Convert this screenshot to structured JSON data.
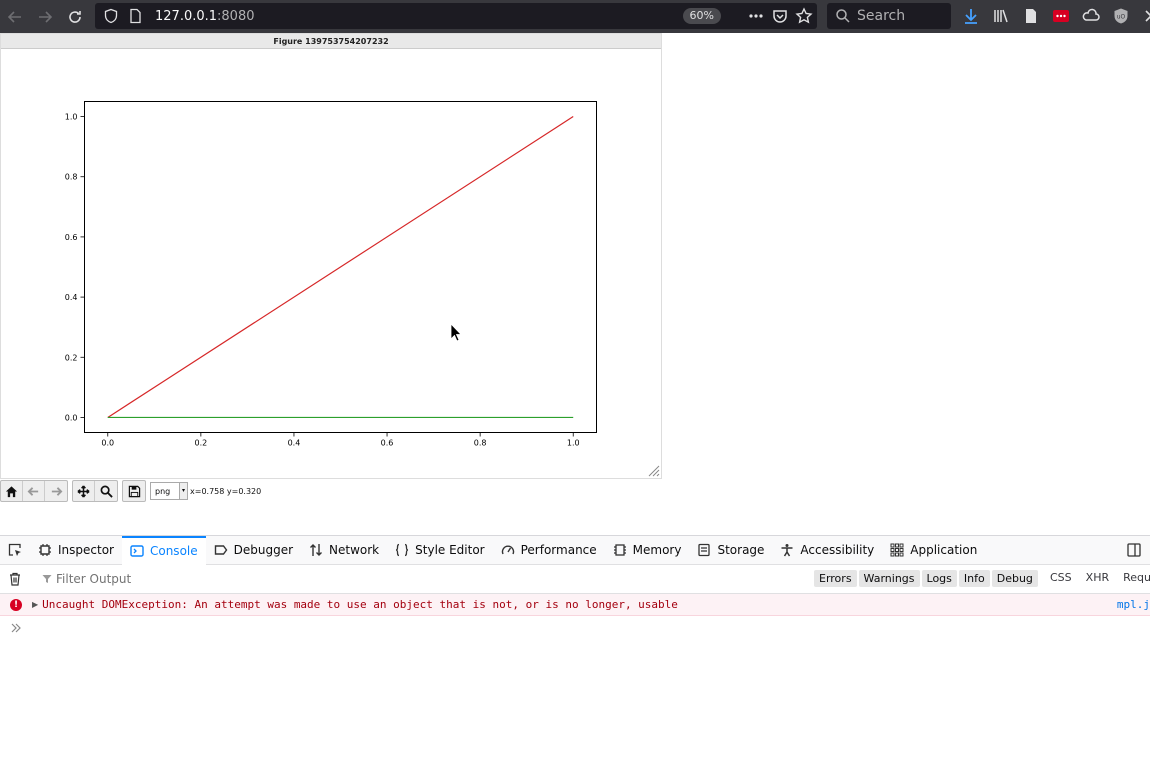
{
  "browser": {
    "url_host": "127.0.0.1",
    "url_port": ":8080",
    "zoom": "60%",
    "search_placeholder": "Search"
  },
  "figure": {
    "title": "Figure 139753754207232",
    "coord_readout": "x=0.758 y=0.320",
    "format_selected": "png"
  },
  "chart_data": {
    "type": "line",
    "xlim": [
      -0.05,
      1.05
    ],
    "ylim": [
      -0.05,
      1.05
    ],
    "x_ticks": [
      "0.0",
      "0.2",
      "0.4",
      "0.6",
      "0.8",
      "1.0"
    ],
    "y_ticks": [
      "0.0",
      "0.2",
      "0.4",
      "0.6",
      "0.8",
      "1.0"
    ],
    "grid": false,
    "series": [
      {
        "color": "#d62728",
        "x": [
          0,
          1
        ],
        "y": [
          0,
          1
        ]
      },
      {
        "color": "#2ca02c",
        "x": [
          0,
          1
        ],
        "y": [
          0,
          0
        ]
      }
    ]
  },
  "devtools": {
    "tabs": [
      {
        "label": "Inspector",
        "icon": "inspector-icon"
      },
      {
        "label": "Console",
        "icon": "console-icon"
      },
      {
        "label": "Debugger",
        "icon": "debugger-icon"
      },
      {
        "label": "Network",
        "icon": "network-icon"
      },
      {
        "label": "Style Editor",
        "icon": "style-editor-icon"
      },
      {
        "label": "Performance",
        "icon": "performance-icon"
      },
      {
        "label": "Memory",
        "icon": "memory-icon"
      },
      {
        "label": "Storage",
        "icon": "storage-icon"
      },
      {
        "label": "Accessibility",
        "icon": "accessibility-icon"
      },
      {
        "label": "Application",
        "icon": "application-icon"
      }
    ],
    "active_tab": "Console",
    "filter_placeholder": "Filter Output",
    "levels": [
      "Errors",
      "Warnings",
      "Logs",
      "Info",
      "Debug"
    ],
    "types": [
      "CSS",
      "XHR",
      "Reques"
    ],
    "error": {
      "message": "Uncaught DOMException: An attempt was made to use an object that is not, or is no longer, usable",
      "source": "mpl.j"
    }
  }
}
